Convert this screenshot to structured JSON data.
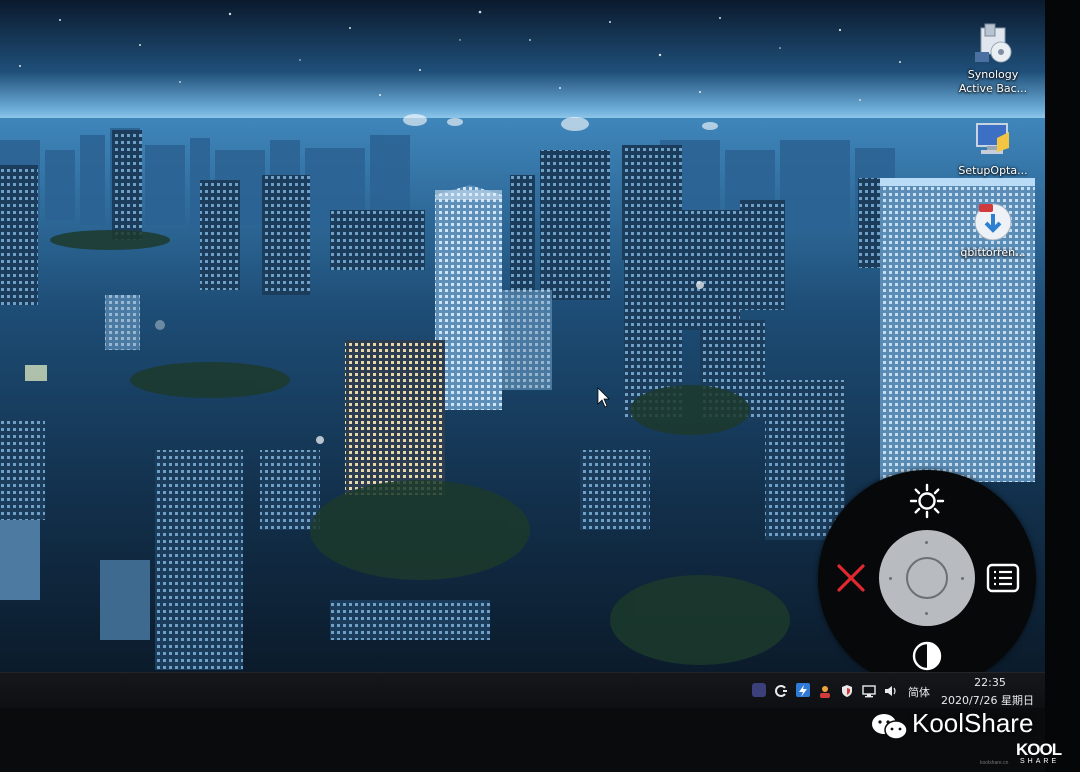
{
  "desktop": {
    "icons": [
      {
        "label_line1": "Synology",
        "label_line2": "Active Bac...",
        "icon": "installer-disc-icon"
      },
      {
        "label": "SetupOpta...",
        "icon": "setup-computer-icon"
      },
      {
        "label": "qbittorren...",
        "icon": "qbittorrent-icon"
      }
    ],
    "cursor": "mouse-pointer-icon"
  },
  "osd_menu": {
    "top": {
      "icon": "brightness-icon"
    },
    "left": {
      "icon": "close-x-icon",
      "color": "#e0282e"
    },
    "right": {
      "icon": "menu-list-icon"
    },
    "bottom": {
      "icon": "contrast-icon"
    },
    "center": {
      "icon": "joystick-pad"
    }
  },
  "taskbar": {
    "tray_icons": [
      "app-tray-icon",
      "refresh-tray-icon",
      "thunder-tray-icon",
      "user-tray-icon",
      "shield-tray-icon",
      "network-tray-icon",
      "volume-icon"
    ],
    "ime": "简体",
    "time": "22:35",
    "date": "2020/7/26 星期日"
  },
  "watermark": {
    "name": "KoolShare",
    "logo_text": "KOOL",
    "logo_sub": "SHARE",
    "site": "koolshare.cn"
  }
}
